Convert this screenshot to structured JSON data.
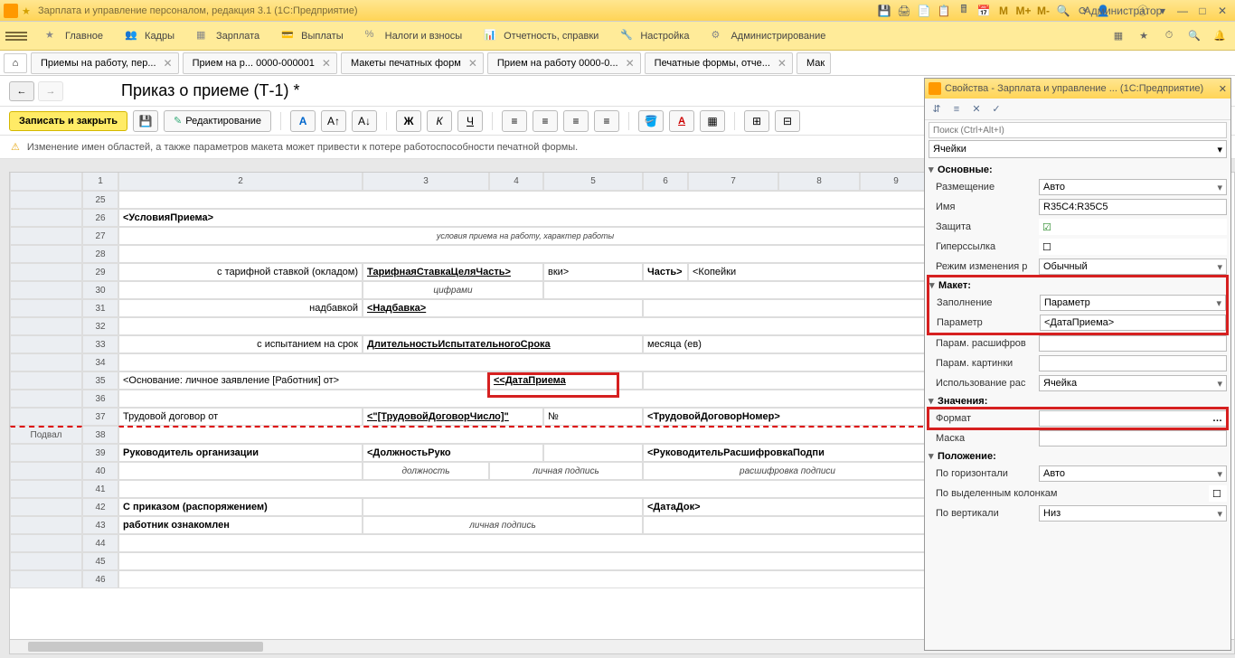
{
  "titlebar": {
    "text": "Зарплата и управление персоналом, редакция 3.1  (1С:Предприятие)",
    "user": "Администратор",
    "m_labels": [
      "M",
      "M+",
      "M-"
    ]
  },
  "mainmenu": {
    "items": [
      "Главное",
      "Кадры",
      "Зарплата",
      "Выплаты",
      "Налоги и взносы",
      "Отчетность, справки",
      "Настройка",
      "Администрирование"
    ]
  },
  "tabs": {
    "items": [
      "Приемы на работу, пер...",
      "Прием на р... 0000-000001",
      "Макеты печатных форм",
      "Прием на работу 0000-0...",
      "Печатные формы, отче...",
      "Мак"
    ]
  },
  "docheader": {
    "title": "Приказ о приеме (Т-1) *"
  },
  "toolbar": {
    "save_close": "Записать и закрыть",
    "edit": "Редактирование"
  },
  "warning": "Изменение имен областей, а также параметров макета может привести к потере работоспособности печатной формы.",
  "grid": {
    "cols": [
      "",
      "1",
      "2",
      "3",
      "4",
      "5",
      "6",
      "7",
      "8",
      "9"
    ],
    "side_label": "Подвал",
    "rows": {
      "25": [],
      "26": {
        "c2": "<УсловияПриема>"
      },
      "27": {
        "wide": "условия приема на работу, характер работы"
      },
      "28": [],
      "29": {
        "c2": "с тарифной ставкой (окладом)",
        "c3": "ТарифнаяСтавкаЦеляЧасть>",
        "c5": "вки>",
        "c6": "Часть>",
        "c7": "<Копейки"
      },
      "30": {
        "under": "цифрами"
      },
      "31": {
        "c2r": "надбавкой",
        "c3": "<Надбавка>"
      },
      "32": [],
      "33": {
        "c2r": "с испытанием на срок",
        "c3": "ДлительностьИспытательногоСрока",
        "c6": "месяца (ев)"
      },
      "34": [],
      "35": {
        "c2": "<Основание: личное заявление [Работник] от>",
        "c4": "<<ДатаПриема"
      },
      "36": [],
      "37": {
        "c2": "Трудовой договор от",
        "c3": "<\"[ТрудовойДоговорЧисло]\"",
        "c5": "№",
        "c6": "<ТрудовойДоговорНомер>"
      },
      "38": [],
      "39": {
        "c2": "Руководитель организации",
        "c3": "<ДолжностьРуко",
        "c6": "<РуководительРасшифровкаПодпи"
      },
      "40": {
        "u1": "должность",
        "u2": "личная подпись",
        "u3": "расшифровка  подписи"
      },
      "41": [],
      "42": {
        "c2": "С приказом (распоряжением)",
        "c6": "<ДатаДок>"
      },
      "43": {
        "c2": "работник ознакомлен",
        "u": "личная подпись"
      },
      "44": [],
      "45": [],
      "46": []
    }
  },
  "props": {
    "title": "Свойства - Зарплата и управление ...  (1С:Предприятие)",
    "search_ph": "Поиск (Ctrl+Alt+I)",
    "selector": "Ячейки",
    "groups": {
      "main": {
        "label": "Основные:",
        "rows": [
          {
            "name": "Размещение",
            "val": "Авто",
            "dd": true
          },
          {
            "name": "Имя",
            "val": "R35C4:R35C5"
          },
          {
            "name": "Защита",
            "check": true,
            "checked": true
          },
          {
            "name": "Гиперссылка",
            "check": true,
            "checked": false
          },
          {
            "name": "Режим изменения р",
            "val": "Обычный",
            "dd": true
          }
        ]
      },
      "maket": {
        "label": "Макет:",
        "rows": [
          {
            "name": "Заполнение",
            "val": "Параметр",
            "dd": true
          },
          {
            "name": "Параметр",
            "val": "<ДатаПриема>"
          },
          {
            "name": "Парам. расшифров",
            "val": ""
          },
          {
            "name": "Парам. картинки",
            "val": ""
          },
          {
            "name": "Использование рас",
            "val": "Ячейка",
            "dd": true
          }
        ]
      },
      "values": {
        "label": "Значения:",
        "rows": [
          {
            "name": "Формат",
            "val": "",
            "ellip": true
          },
          {
            "name": "Маска",
            "val": ""
          }
        ]
      },
      "pos": {
        "label": "Положение:",
        "rows": [
          {
            "name": "По горизонтали",
            "val": "Авто",
            "dd": true
          },
          {
            "name": "По выделенным колонкам",
            "check": true,
            "checked": false
          },
          {
            "name": "По вертикали",
            "val": "Низ",
            "dd": true
          }
        ]
      }
    }
  }
}
